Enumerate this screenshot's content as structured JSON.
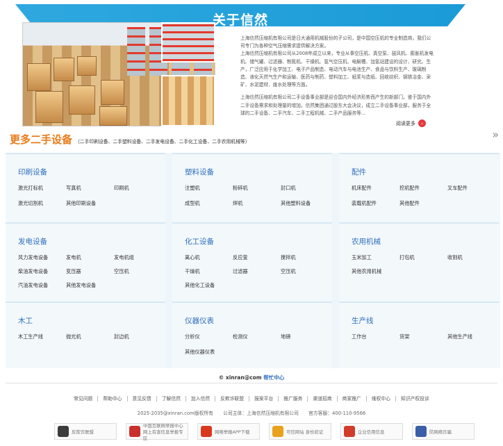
{
  "about": {
    "title": "关于信然",
    "para1": "上海信然压缩机有限公司是日大通用机械股份的子公司，是中国空压机的专业制造商，我们公司专门为各种空气压缩需求提供解决方案。",
    "para2": "上海信然压缩机有限公司从2008年成立以来，专业从事空压机、真空泵、鼓风机、膨胀机发电机、储气罐、过滤器、制氮机、干燥机、氢气空压机、电解槽、加氢站建设的设计、研究、生产，广泛应用于化学加工、电子产品制造、电动汽车与电池生产、食品与饮料生产、玻璃制造、液化天然气生产和运输、医药与制药、塑料加工、纸浆与造纸、回收纺织、钢铁冶金、采矿、水泥建材、废水处理等方面。",
    "para3": "上海信然压缩机有限公司二手设备事业部是迎合国内外经济形势而产生的新部门，鉴于国内外二手设备需求和处理量的增加，信然集团通过股东大会决议，成立二手设备事业部，服务于全球的二手设备、二手汽车、二手工程机械、二手产品服务等...",
    "readmore": "阅读更多"
  },
  "more": {
    "title": "更多二手设备",
    "subtitle": "（二手印刷设备、二手塑料设备、二手发电设备、二手化工设备、二手农用机械等）",
    "arrow": "»"
  },
  "categories": [
    {
      "title": "印刷设备",
      "items": [
        "激光打标机",
        "写真机",
        "印刷机",
        "激光切割机",
        "其他印刷设备"
      ]
    },
    {
      "title": "塑料设备",
      "items": [
        "注塑机",
        "粉碎机",
        "封口机",
        "成型机",
        "焊机",
        "其他塑料设备"
      ]
    },
    {
      "title": "配件",
      "items": [
        "机床配件",
        "挖机配件",
        "叉车配件",
        "装载机配件",
        "其他配件"
      ]
    },
    {
      "title": "发电设备",
      "items": [
        "风力发电设备",
        "发电机",
        "发电机组",
        "柴油发电设备",
        "变压器",
        "空压机",
        "汽油发电设备",
        "其他发电设备"
      ]
    },
    {
      "title": "化工设备",
      "items": [
        "离心机",
        "反应釜",
        "搅拌机",
        "干燥机",
        "过滤器",
        "空压机",
        "其他化工设备"
      ]
    },
    {
      "title": "农用机械",
      "items": [
        "玉米加工",
        "打包机",
        "收割机",
        "其他农用机械"
      ]
    },
    {
      "title": "木工",
      "items": [
        "木工生产线",
        "抛光机",
        "封边机"
      ]
    },
    {
      "title": "仪器仪表",
      "items": [
        "分析仪",
        "检测仪",
        "地磅",
        "其他仪器仪表"
      ]
    },
    {
      "title": "生产线",
      "items": [
        "工作台",
        "货架",
        "其他生产线"
      ]
    }
  ],
  "footer": {
    "copyright": "© xinran@com",
    "help": "帮忙中心",
    "links": [
      "常见问题",
      "帮助中心",
      "意见反馈",
      "了解信然",
      "加入信然",
      "反欺诈联盟",
      "报案平台",
      "推广服务",
      "渠道招商",
      "商家推广",
      "维权中心",
      "知识产权投诉"
    ],
    "icp": [
      "2025-2035@xinran.com版权所有",
      "公司主体：上海信然压缩机有限公司",
      "官方客服：400-110-9566"
    ],
    "badges": [
      {
        "label": "反欺诈联盟",
        "color": "#3b3b3b"
      },
      {
        "label": "中国互联网举报中心 网上有害信息举报专区",
        "color": "#c9302c"
      },
      {
        "label": "网络举报APP下载",
        "color": "#d9381e"
      },
      {
        "label": "可信网站 身份验证",
        "color": "#e8a21c"
      },
      {
        "label": "企业信用信息",
        "color": "#d13b2a"
      },
      {
        "label": "防网络诈骗",
        "color": "#3a5ea8"
      }
    ]
  }
}
